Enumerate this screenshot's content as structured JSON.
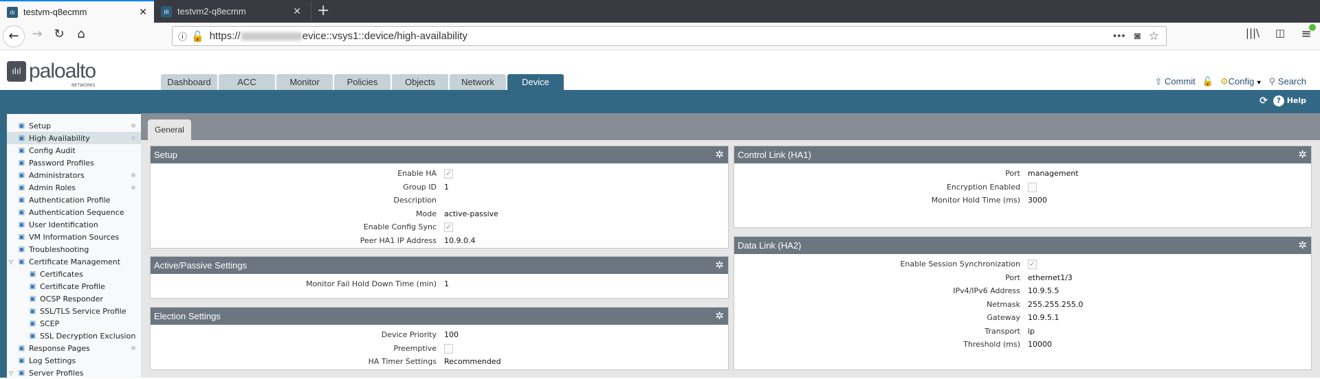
{
  "browser": {
    "tabs": [
      {
        "title": "testvm-q8ecmm",
        "active": true
      },
      {
        "title": "testvm2-q8ecmm",
        "active": false
      }
    ],
    "url_prefix": "https://",
    "url_suffix": "evice::vsys1::device/high-availability"
  },
  "app": {
    "logo": {
      "name": "paloalto",
      "sub": "NETWORKS"
    },
    "main_tabs": [
      "Dashboard",
      "ACC",
      "Monitor",
      "Policies",
      "Objects",
      "Network",
      "Device"
    ],
    "active_tab": "Device",
    "actions": {
      "commit": "Commit",
      "config": "Config",
      "search": "Search",
      "help": "Help"
    }
  },
  "sidebar": {
    "items": [
      {
        "label": "Setup",
        "icon": "setup-icon",
        "dot": true
      },
      {
        "label": "High Availability",
        "icon": "ha-icon",
        "dot": true,
        "selected": true
      },
      {
        "label": "Config Audit",
        "icon": "audit-icon"
      },
      {
        "label": "Password Profiles",
        "icon": "key-icon"
      },
      {
        "label": "Administrators",
        "icon": "admin-icon",
        "dot": true
      },
      {
        "label": "Admin Roles",
        "icon": "admin-roles-icon",
        "dot": true
      },
      {
        "label": "Authentication Profile",
        "icon": "auth-profile-icon"
      },
      {
        "label": "Authentication Sequence",
        "icon": "auth-sequence-icon"
      },
      {
        "label": "User Identification",
        "icon": "user-id-icon"
      },
      {
        "label": "VM Information Sources",
        "icon": "vm-icon"
      },
      {
        "label": "Troubleshooting",
        "icon": "tools-icon"
      },
      {
        "label": "Certificate Management",
        "icon": "cert-folder-icon",
        "expanded": true
      },
      {
        "label": "Certificates",
        "icon": "certificate-icon",
        "indent": true
      },
      {
        "label": "Certificate Profile",
        "icon": "certificate-icon",
        "indent": true
      },
      {
        "label": "OCSP Responder",
        "icon": "ocsp-icon",
        "indent": true
      },
      {
        "label": "SSL/TLS Service Profile",
        "icon": "lock-icon",
        "indent": true
      },
      {
        "label": "SCEP",
        "icon": "scep-icon",
        "indent": true
      },
      {
        "label": "SSL Decryption Exclusion",
        "icon": "lock-icon",
        "indent": true
      },
      {
        "label": "Response Pages",
        "icon": "response-pages-icon",
        "dot": true
      },
      {
        "label": "Log Settings",
        "icon": "log-icon"
      },
      {
        "label": "Server Profiles",
        "icon": "server-folder-icon",
        "expanded": true
      }
    ]
  },
  "content_tab": "General",
  "panels": {
    "setup": {
      "title": "Setup",
      "rows": [
        {
          "label": "Enable HA",
          "type": "checkbox",
          "checked": true
        },
        {
          "label": "Group ID",
          "value": "1"
        },
        {
          "label": "Description",
          "value": ""
        },
        {
          "label": "Mode",
          "value": "active-passive"
        },
        {
          "label": "Enable Config Sync",
          "type": "checkbox",
          "checked": true
        },
        {
          "label": "Peer HA1 IP Address",
          "value": "10.9.0.4"
        }
      ]
    },
    "active_passive": {
      "title": "Active/Passive Settings",
      "rows": [
        {
          "label": "Monitor Fail Hold Down Time (min)",
          "value": "1"
        }
      ]
    },
    "election": {
      "title": "Election Settings",
      "rows": [
        {
          "label": "Device Priority",
          "value": "100"
        },
        {
          "label": "Preemptive",
          "type": "checkbox",
          "checked": false
        },
        {
          "label": "HA Timer Settings",
          "value": "Recommended"
        }
      ]
    },
    "control_link": {
      "title": "Control Link (HA1)",
      "rows": [
        {
          "label": "Port",
          "value": "management"
        },
        {
          "label": "Encryption Enabled",
          "type": "checkbox",
          "checked": false
        },
        {
          "label": "Monitor Hold Time (ms)",
          "value": "3000"
        }
      ]
    },
    "data_link": {
      "title": "Data Link (HA2)",
      "rows": [
        {
          "label": "Enable Session Synchronization",
          "type": "checkbox",
          "checked": true
        },
        {
          "label": "Port",
          "value": "ethernet1/3"
        },
        {
          "label": "IPv4/IPv6 Address",
          "value": "10.9.5.5"
        },
        {
          "label": "Netmask",
          "value": "255.255.255.0"
        },
        {
          "label": "Gateway",
          "value": "10.9.5.1"
        },
        {
          "label": "Transport",
          "value": "ip"
        },
        {
          "label": "Threshold (ms)",
          "value": "10000"
        }
      ]
    }
  }
}
